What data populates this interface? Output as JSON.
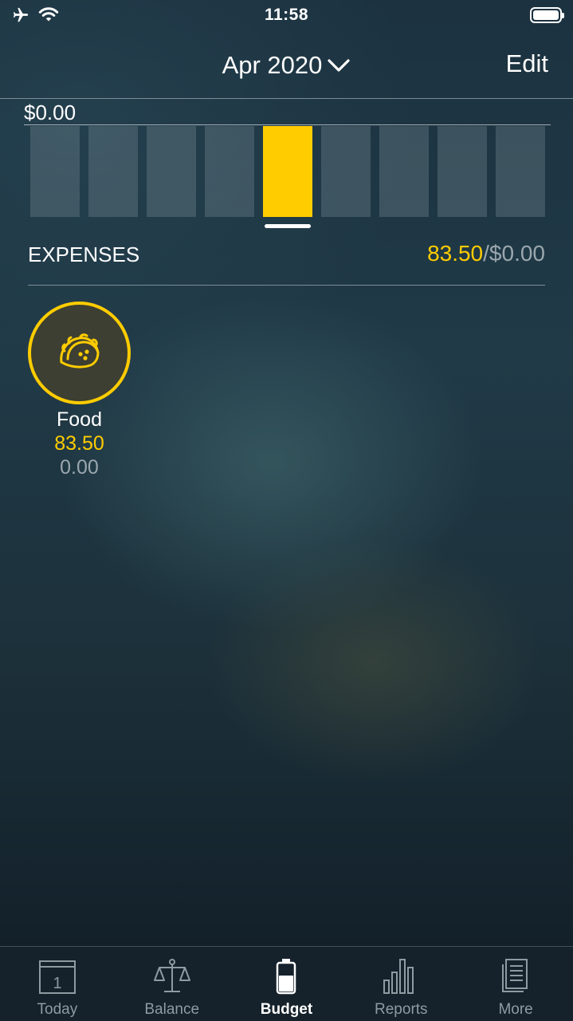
{
  "status_bar": {
    "time": "11:58"
  },
  "header": {
    "month": "Apr 2020",
    "edit_label": "Edit"
  },
  "chart_data": {
    "type": "bar",
    "ylabel_value": "$0.00",
    "bar_count": 9,
    "selected_index": 4,
    "selected_color": "#ffcc00"
  },
  "expenses": {
    "title": "EXPENSES",
    "spent": "83.50",
    "budget": "/$0.00"
  },
  "categories": [
    {
      "name": "Food",
      "spent": "83.50",
      "budget": "0.00",
      "icon": "taco-icon"
    }
  ],
  "tabs": [
    {
      "label": "Today",
      "icon": "calendar-icon",
      "active": false
    },
    {
      "label": "Balance",
      "icon": "scale-icon",
      "active": false
    },
    {
      "label": "Budget",
      "icon": "battery-icon",
      "active": true
    },
    {
      "label": "Reports",
      "icon": "bar-chart-icon",
      "active": false
    },
    {
      "label": "More",
      "icon": "document-icon",
      "active": false
    }
  ],
  "colors": {
    "accent": "#ffcc00",
    "muted": "#9aa7ae"
  }
}
